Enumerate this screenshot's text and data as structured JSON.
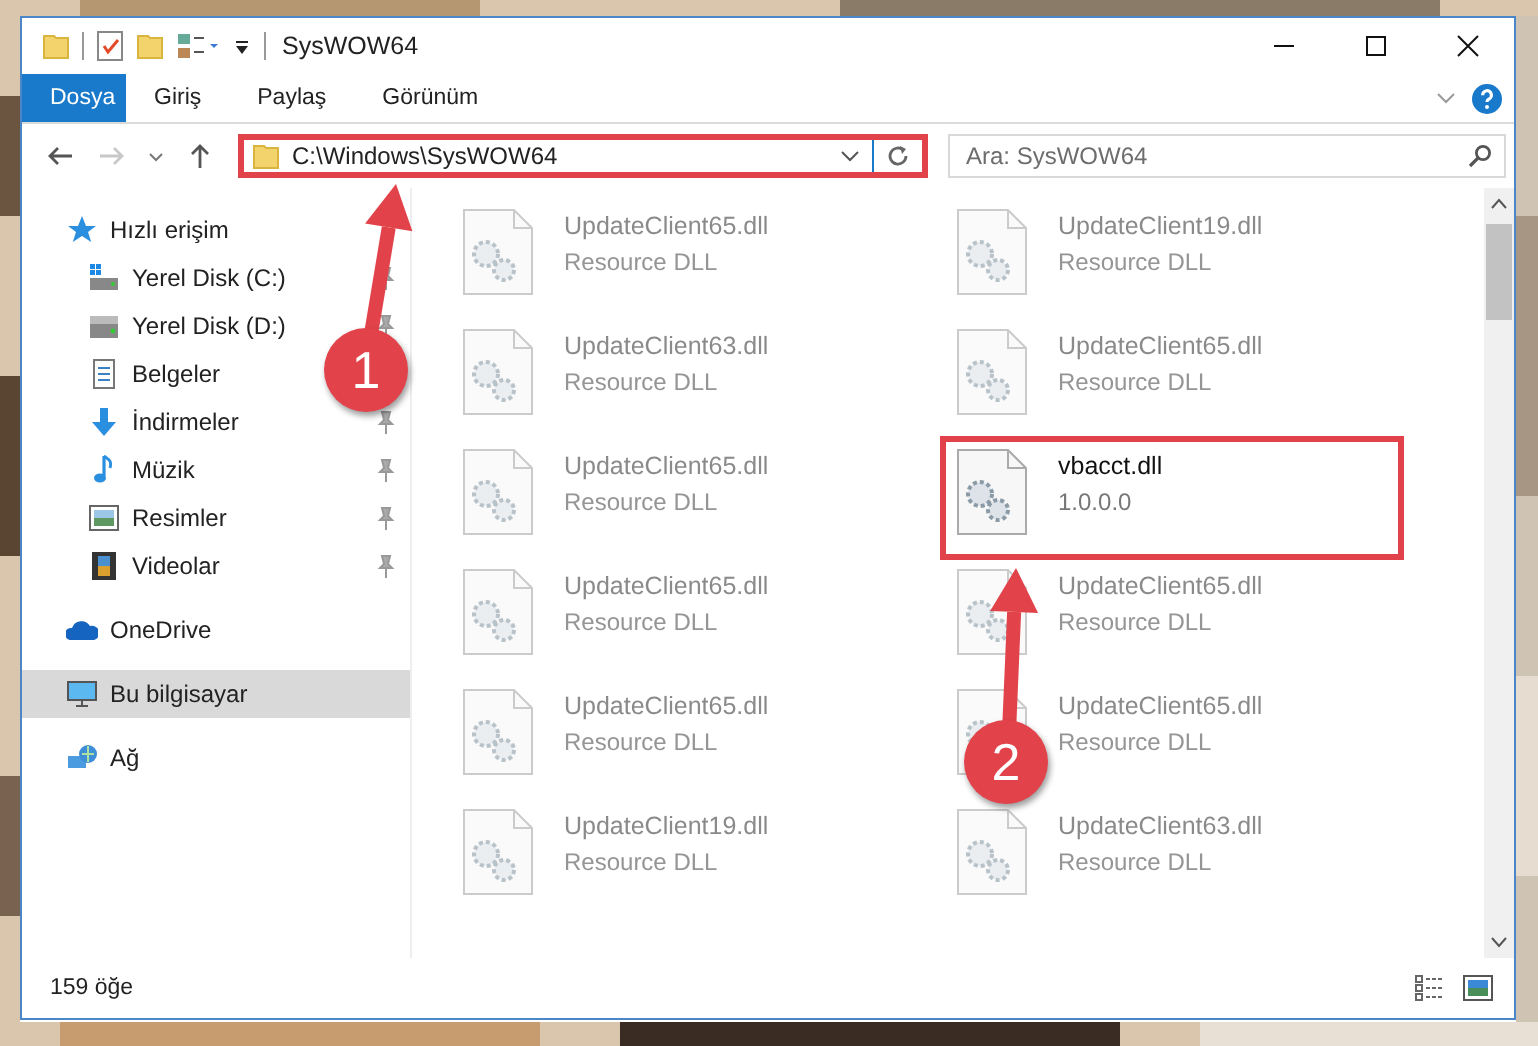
{
  "window": {
    "title": "SysWOW64"
  },
  "ribbon_tabs": [
    {
      "label": "Dosya",
      "selected": true
    },
    {
      "label": "Giriş",
      "selected": false
    },
    {
      "label": "Paylaş",
      "selected": false
    },
    {
      "label": "Görünüm",
      "selected": false
    }
  ],
  "address": {
    "path": "C:\\Windows\\SysWOW64",
    "highlighted": true
  },
  "search": {
    "placeholder": "Ara: SysWOW64"
  },
  "sidebar": {
    "items": [
      {
        "label": "Hızlı erişim",
        "kind": "star",
        "selected": false,
        "children": [
          {
            "label": "Yerel Disk (C:)",
            "kind": "system-drive",
            "selected": false,
            "pinned": true
          },
          {
            "label": "Yerel Disk (D:)",
            "kind": "drive",
            "selected": false,
            "pinned": true
          },
          {
            "label": "Belgeler",
            "kind": "documents",
            "selected": false
          },
          {
            "label": "İndirmeler",
            "kind": "downloads",
            "selected": false,
            "pinned": true
          },
          {
            "label": "Müzik",
            "kind": "music",
            "selected": false,
            "pinned": true
          },
          {
            "label": "Resimler",
            "kind": "pictures",
            "selected": false,
            "pinned": true
          },
          {
            "label": "Videolar",
            "kind": "videos",
            "selected": false,
            "pinned": true
          }
        ]
      },
      {
        "label": "OneDrive",
        "kind": "cloud",
        "selected": false
      },
      {
        "label": "Bu bilgisayar",
        "kind": "computer",
        "selected": true
      },
      {
        "label": "Ağ",
        "kind": "network",
        "selected": false
      }
    ]
  },
  "files": [
    {
      "name": "UpdateClient65.dll",
      "detail": "Resource DLL",
      "blurred": true,
      "highlighted": false
    },
    {
      "name": "UpdateClient19.dll",
      "detail": "Resource DLL",
      "blurred": true,
      "highlighted": false
    },
    {
      "name": "UpdateClient63.dll",
      "detail": "Resource DLL",
      "blurred": true,
      "highlighted": false
    },
    {
      "name": "UpdateClient65.dll",
      "detail": "Resource DLL",
      "blurred": true,
      "highlighted": false
    },
    {
      "name": "UpdateClient65.dll",
      "detail": "Resource DLL",
      "blurred": true,
      "highlighted": false
    },
    {
      "name": "vbacct.dll",
      "detail": "1.0.0.0",
      "blurred": false,
      "highlighted": true
    },
    {
      "name": "UpdateClient65.dll",
      "detail": "Resource DLL",
      "blurred": true,
      "highlighted": false
    },
    {
      "name": "UpdateClient65.dll",
      "detail": "Resource DLL",
      "blurred": true,
      "highlighted": false
    },
    {
      "name": "UpdateClient65.dll",
      "detail": "Resource DLL",
      "blurred": true,
      "highlighted": false
    },
    {
      "name": "UpdateClient65.dll",
      "detail": "Resource DLL",
      "blurred": true,
      "highlighted": false
    },
    {
      "name": "UpdateClient19.dll",
      "detail": "Resource DLL",
      "blurred": true,
      "highlighted": false
    },
    {
      "name": "UpdateClient63.dll",
      "detail": "Resource DLL",
      "blurred": true,
      "highlighted": false
    }
  ],
  "callouts": [
    {
      "number": "1"
    },
    {
      "number": "2"
    }
  ],
  "status_bar": {
    "item_count": "159 öğe"
  }
}
